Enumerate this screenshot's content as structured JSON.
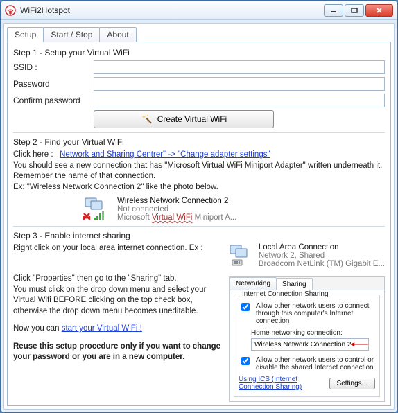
{
  "window": {
    "title": "WiFi2Hotspot"
  },
  "tabs": {
    "setup": "Setup",
    "startstop": "Start / Stop",
    "about": "About"
  },
  "step1": {
    "title": "Step 1 - Setup your Virtual WiFi",
    "ssid_label": "SSID :",
    "password_label": "Password",
    "confirm_label": "Confirm password",
    "create_btn": "Create Virtual WiFi"
  },
  "step2": {
    "title": "Step 2 - Find your Virtual WiFi",
    "click_here": "Click here :",
    "link": "Network and Sharing Centrer\" -> \"Change adapter settings\"",
    "desc1": "You should see a new connection that has \"Microsoft Virtual WiFi Miniport Adapter\" written underneath it. Remember the name of that connection.",
    "desc2": "Ex: \"Wireless Network Connection 2\" like the photo below.",
    "conn_name": "Wireless Network Connection 2",
    "conn_state": "Not connected",
    "conn_desc_pre": "Microsoft ",
    "conn_desc_ul": "Virtual WiFi",
    "conn_desc_post": " Miniport A..."
  },
  "step3": {
    "title": "Step 3 - Enable internet sharing",
    "right_click": "Right click on your local area internet connection. Ex :",
    "lac_name": "Local Area Connection",
    "lac_state": "Network  2, Shared",
    "lac_desc": "Broadcom NetLink (TM) Gigabit E...",
    "para1": "Click \"Properties\" then go to the \"Sharing\" tab.",
    "para2": "You must click on the drop down menu and select your Virtual Wifi BEFORE clicking on the top check box, otherwise the drop down menu becomes uneditable.",
    "now_pre": "Now you can  ",
    "now_link": "start your Virtual WiFi !",
    "reuse": "Reuse this setup procedure only if you want to change your password or you are in a new computer."
  },
  "sharing": {
    "tab_net": "Networking",
    "tab_share": "Sharing",
    "group_title": "Internet Connection Sharing",
    "chk1": "Allow other network users to connect through this computer's Internet connection",
    "home_label": "Home networking connection:",
    "home_value": "Wireless Network Connection 2",
    "chk2": "Allow other network users to control or disable the shared Internet connection",
    "ics_link": "Using ICS (Internet Connection Sharing)",
    "settings_btn": "Settings..."
  }
}
